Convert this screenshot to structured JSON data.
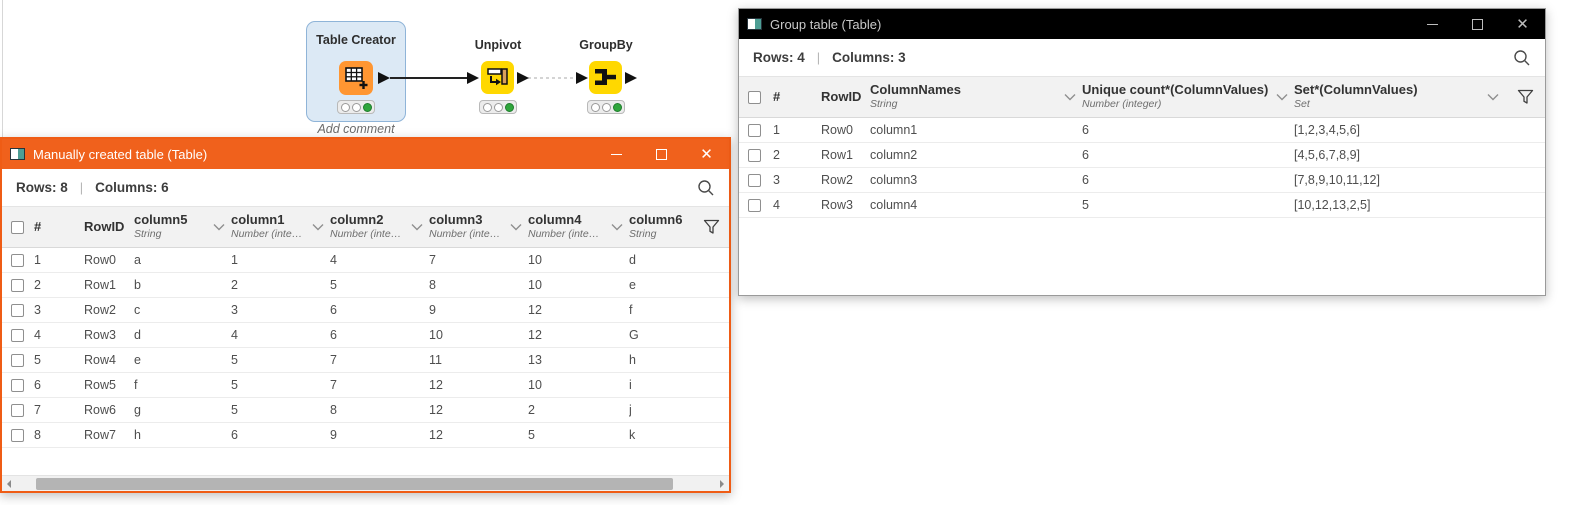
{
  "colors": {
    "accent_orange": "#f0611c",
    "titlebar_black": "#000000",
    "node_yellow": "#ffd800",
    "node_orange": "#ff9632",
    "status_green": "#2fa63c",
    "selection_blue": "#dce9f5"
  },
  "icons": {
    "window": "table-window-icon",
    "search": "magnifier",
    "filter": "funnel",
    "column_menu": "chevron-down",
    "minimize": "minimize-dash",
    "maximize": "maximize-square",
    "close": "close-x"
  },
  "canvas": {
    "nodes": [
      {
        "label": "Table Creator",
        "comment": "Add comment",
        "status": "executed",
        "selected": true
      },
      {
        "label": "Unpivot",
        "status": "executed",
        "selected": false
      },
      {
        "label": "GroupBy",
        "status": "executed",
        "selected": false
      }
    ]
  },
  "windows": [
    {
      "title": "Manually created table (Table)",
      "rows_label": "Rows: 8",
      "separator": "|",
      "cols_label": "Columns: 6",
      "columns": [
        {
          "label": "#"
        },
        {
          "label": "RowID"
        },
        {
          "label": "column5",
          "type": "String",
          "chevron": true
        },
        {
          "label": "column1",
          "type": "Number (inte…",
          "chevron": true
        },
        {
          "label": "column2",
          "type": "Number (inte…",
          "chevron": true
        },
        {
          "label": "column3",
          "type": "Number (inte…",
          "chevron": true
        },
        {
          "label": "column4",
          "type": "Number (inte…",
          "chevron": true
        },
        {
          "label": "column6",
          "type": "String",
          "chevron": false
        }
      ],
      "rows": [
        [
          "1",
          "Row0",
          "a",
          "1",
          "4",
          "7",
          "10",
          "d"
        ],
        [
          "2",
          "Row1",
          "b",
          "2",
          "5",
          "8",
          "10",
          "e"
        ],
        [
          "3",
          "Row2",
          "c",
          "3",
          "6",
          "9",
          "12",
          "f"
        ],
        [
          "4",
          "Row3",
          "d",
          "4",
          "6",
          "10",
          "12",
          "G"
        ],
        [
          "5",
          "Row4",
          "e",
          "5",
          "7",
          "11",
          "13",
          "h"
        ],
        [
          "6",
          "Row5",
          "f",
          "5",
          "7",
          "12",
          "10",
          "i"
        ],
        [
          "7",
          "Row6",
          "g",
          "5",
          "8",
          "12",
          "2",
          "j"
        ],
        [
          "8",
          "Row7",
          "h",
          "6",
          "9",
          "12",
          "5",
          "k"
        ]
      ],
      "has_hscrollbar": true
    },
    {
      "title": "Group table (Table)",
      "rows_label": "Rows: 4",
      "separator": "|",
      "cols_label": "Columns: 3",
      "columns": [
        {
          "label": "#"
        },
        {
          "label": "RowID"
        },
        {
          "label": "ColumnNames",
          "type": "String",
          "chevron": true
        },
        {
          "label": "Unique count*(ColumnValues)",
          "type": "Number (integer)",
          "chevron": true
        },
        {
          "label": "Set*(ColumnValues)",
          "type": "Set",
          "chevron": true
        }
      ],
      "rows": [
        [
          "1",
          "Row0",
          "column1",
          "6",
          "[1,2,3,4,5,6]"
        ],
        [
          "2",
          "Row1",
          "column2",
          "6",
          "[4,5,6,7,8,9]"
        ],
        [
          "3",
          "Row2",
          "column3",
          "6",
          "[7,8,9,10,11,12]"
        ],
        [
          "4",
          "Row3",
          "column4",
          "5",
          "[10,12,13,2,5]"
        ]
      ],
      "has_hscrollbar": false
    }
  ]
}
